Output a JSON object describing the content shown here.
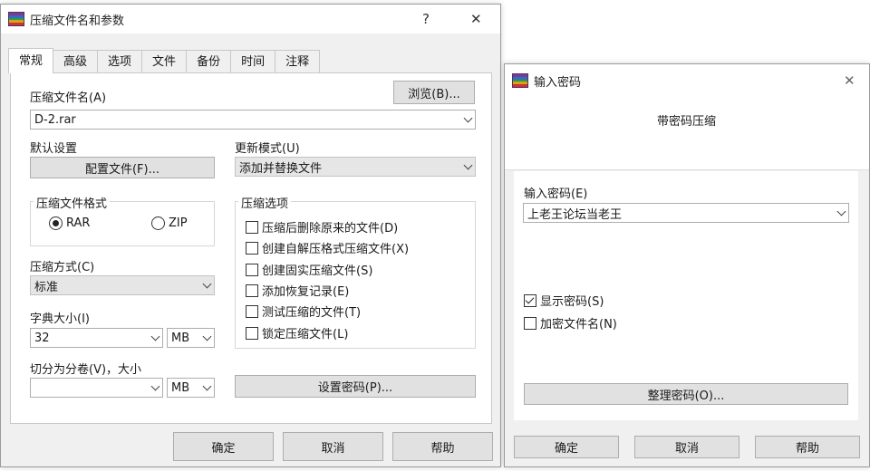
{
  "main_dialog": {
    "title": "压缩文件名和参数",
    "help_symbol": "?",
    "close_symbol": "✕",
    "tabs": [
      "常规",
      "高级",
      "选项",
      "文件",
      "备份",
      "时间",
      "注释"
    ],
    "archive_name_label": "压缩文件名(A)",
    "archive_name_value": "D-2.rar",
    "browse_label": "浏览(B)...",
    "default_settings_label": "默认设置",
    "profiles_label": "配置文件(F)...",
    "update_mode_label": "更新模式(U)",
    "update_mode_value": "添加并替换文件",
    "archive_format_title": "压缩文件格式",
    "format_options": [
      {
        "label": "RAR",
        "selected": true
      },
      {
        "label": "ZIP",
        "selected": false
      }
    ],
    "compression_method_label": "压缩方式(C)",
    "compression_method_value": "标准",
    "dictionary_size_label": "字典大小(I)",
    "dictionary_size_value": "32",
    "dictionary_unit": "MB",
    "split_label": "切分为分卷(V)，大小",
    "split_value": "",
    "split_unit": "MB",
    "compression_options_title": "压缩选项",
    "options": [
      {
        "label": "压缩后删除原来的文件(D)",
        "checked": false
      },
      {
        "label": "创建自解压格式压缩文件(X)",
        "checked": false
      },
      {
        "label": "创建固实压缩文件(S)",
        "checked": false
      },
      {
        "label": "添加恢复记录(E)",
        "checked": false
      },
      {
        "label": "测试压缩的文件(T)",
        "checked": false
      },
      {
        "label": "锁定压缩文件(L)",
        "checked": false
      }
    ],
    "set_password_label": "设置密码(P)...",
    "ok_label": "确定",
    "cancel_label": "取消",
    "help_label": "帮助"
  },
  "password_dialog": {
    "title": "输入密码",
    "close_symbol": "✕",
    "heading": "带密码压缩",
    "enter_password_label": "输入密码(E)",
    "password_value": "上老王论坛当老王",
    "show_password_label": "显示密码(S)",
    "show_password_checked": true,
    "encrypt_names_label": "加密文件名(N)",
    "encrypt_names_checked": false,
    "organize_label": "整理密码(O)...",
    "ok_label": "确定",
    "cancel_label": "取消",
    "help_label": "帮助"
  },
  "colors": {
    "window_bg": "#f0f0f0",
    "panel_bg": "#ffffff",
    "button_bg": "#e1e1e1",
    "icon_stripes": [
      "#7a3c8c",
      "#2c6fc0",
      "#2f9b45",
      "#d9a019",
      "#c8362e"
    ]
  }
}
